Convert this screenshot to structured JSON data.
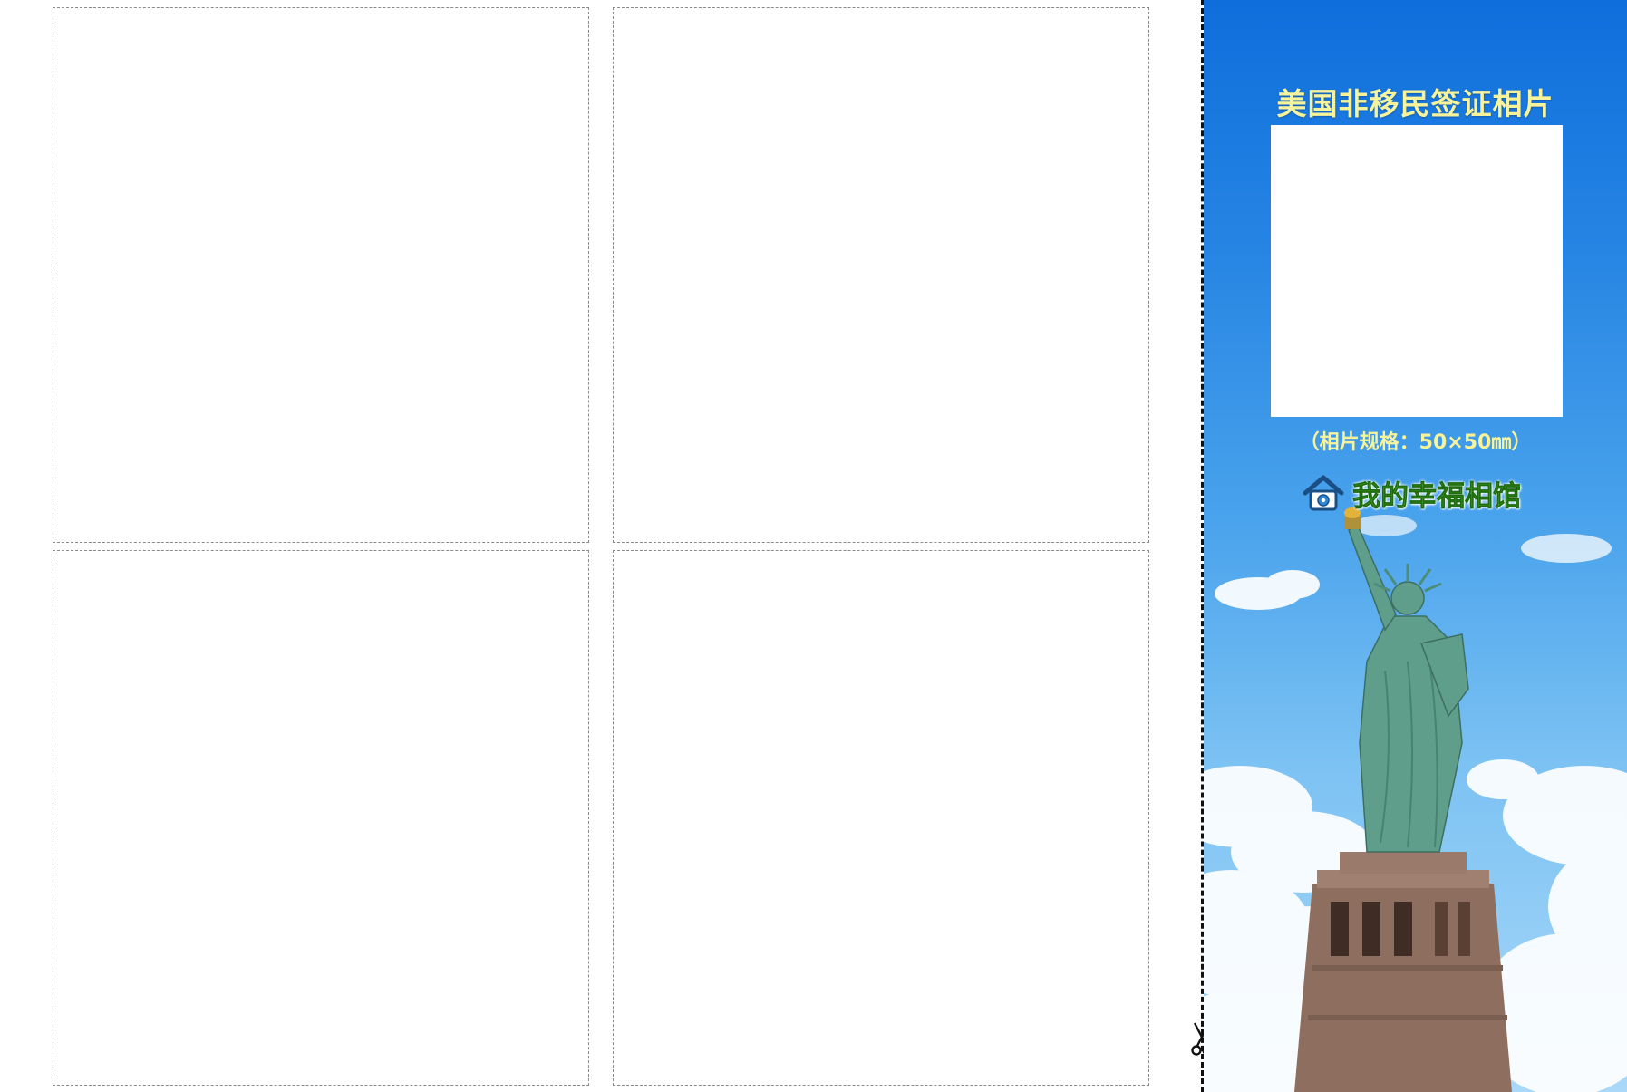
{
  "panel": {
    "title": "美国非移民签证相片",
    "photo_spec": "（相片规格：50×50㎜）",
    "brand_name": "我的幸福相馆",
    "background_top_color": "#0f6edc",
    "background_bottom_color": "#a9d8f8",
    "text_color": "#f7f39a",
    "brand_color": "#3a9a22"
  },
  "icons": {
    "cut_marker": "scissors-icon",
    "brand_logo": "house-icon"
  },
  "slots": {
    "count": 4,
    "border_style": "dashed"
  }
}
